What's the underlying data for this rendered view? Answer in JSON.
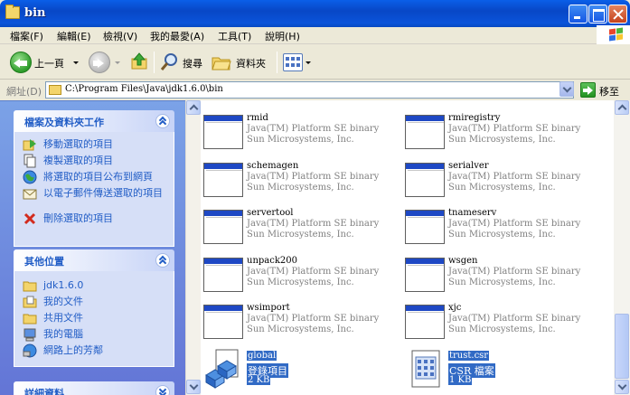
{
  "window": {
    "title": "bin"
  },
  "menu": [
    "檔案(F)",
    "編輯(E)",
    "檢視(V)",
    "我的最愛(A)",
    "工具(T)",
    "說明(H)"
  ],
  "toolbar": {
    "back_label": "上一頁",
    "search_label": "搜尋",
    "folders_label": "資料夾"
  },
  "address": {
    "label": "網址(D)",
    "value": "C:\\Program Files\\Java\\jdk1.6.0\\bin",
    "go_label": "移至"
  },
  "tasks_panel": {
    "title": "檔案及資料夾工作",
    "items": [
      "移動選取的項目",
      "複製選取的項目",
      "將選取的項目公布到網頁",
      "以電子郵件傳送選取的項目",
      "刪除選取的項目"
    ]
  },
  "places_panel": {
    "title": "其他位置",
    "items": [
      "jdk1.6.0",
      "我的文件",
      "共用文件",
      "我的電腦",
      "網路上的芳鄰"
    ]
  },
  "details_panel": {
    "title": "詳細資料"
  },
  "files": [
    {
      "name": "rmid",
      "type": "Java(TM) Platform SE binary",
      "company": "Sun Microsystems, Inc."
    },
    {
      "name": "rmiregistry",
      "type": "Java(TM) Platform SE binary",
      "company": "Sun Microsystems, Inc."
    },
    {
      "name": "schemagen",
      "type": "Java(TM) Platform SE binary",
      "company": "Sun Microsystems, Inc."
    },
    {
      "name": "serialver",
      "type": "Java(TM) Platform SE binary",
      "company": "Sun Microsystems, Inc."
    },
    {
      "name": "servertool",
      "type": "Java(TM) Platform SE binary",
      "company": "Sun Microsystems, Inc."
    },
    {
      "name": "tnameserv",
      "type": "Java(TM) Platform SE binary",
      "company": "Sun Microsystems, Inc."
    },
    {
      "name": "unpack200",
      "type": "Java(TM) Platform SE binary",
      "company": "Sun Microsystems, Inc."
    },
    {
      "name": "wsgen",
      "type": "Java(TM) Platform SE binary",
      "company": "Sun Microsystems, Inc."
    },
    {
      "name": "wsimport",
      "type": "Java(TM) Platform SE binary",
      "company": "Sun Microsystems, Inc."
    },
    {
      "name": "xjc",
      "type": "Java(TM) Platform SE binary",
      "company": "Sun Microsystems, Inc."
    }
  ],
  "selected_files": [
    {
      "name": "global",
      "type": "登錄項目",
      "size": "2 KB"
    },
    {
      "name": "trust.csr",
      "type": "CSR 檔案",
      "size": "1 KB"
    }
  ]
}
